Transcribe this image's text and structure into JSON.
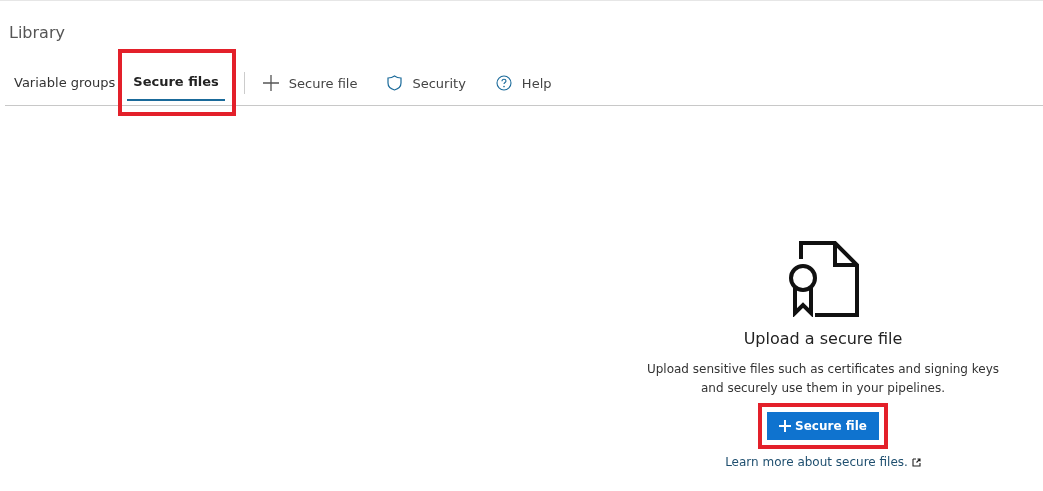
{
  "page": {
    "title": "Library"
  },
  "tabs": [
    {
      "label": "Variable groups",
      "selected": false,
      "highlighted": false
    },
    {
      "label": "Secure files",
      "selected": true,
      "highlighted": true
    }
  ],
  "toolbar": [
    {
      "kind": "add",
      "label": "Secure file"
    },
    {
      "kind": "security",
      "label": "Security"
    },
    {
      "kind": "help",
      "label": "Help"
    }
  ],
  "empty_state": {
    "heading": "Upload a secure file",
    "description": "Upload sensitive files such as certificates and signing keys and securely use them in your pipelines.",
    "button": {
      "label": "Secure file",
      "highlighted": true
    },
    "link": "Learn more about secure files."
  }
}
